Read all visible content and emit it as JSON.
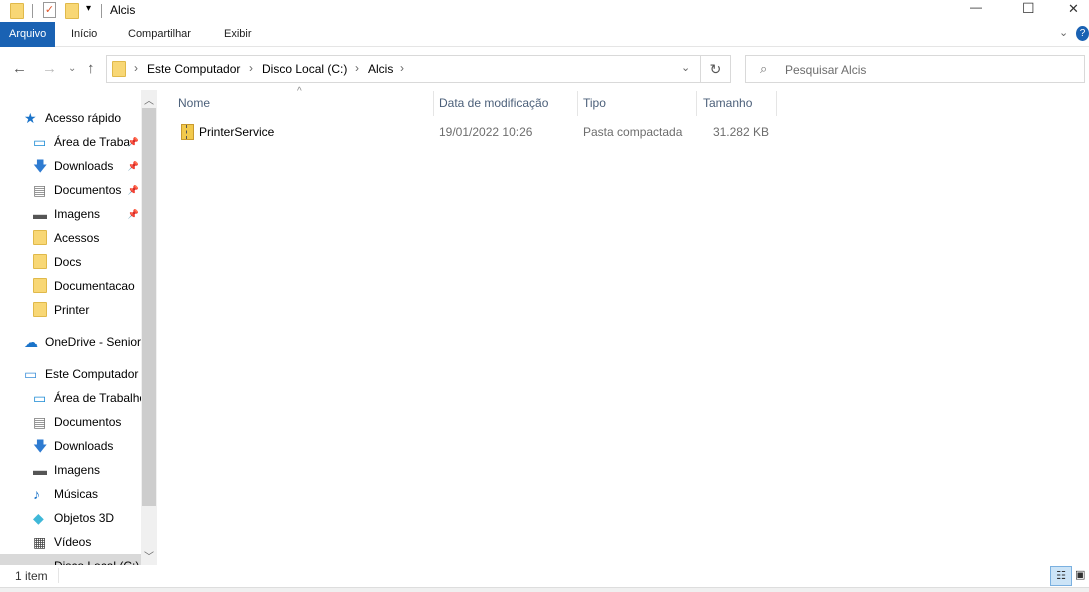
{
  "window": {
    "title": "Alcis",
    "minimize": "—",
    "maximize": "☐",
    "close": "✕"
  },
  "ribbon": {
    "tabs": [
      "Arquivo",
      "Início",
      "Compartilhar",
      "Exibir"
    ],
    "active_color": "#1a62b3"
  },
  "address": {
    "breadcrumbs": [
      "Este Computador",
      "Disco Local (C:)",
      "Alcis"
    ],
    "search_placeholder": "Pesquisar Alcis"
  },
  "nav": {
    "items": [
      {
        "label": "Acesso rápido",
        "icon": "star-icon",
        "level": 0,
        "pinned": false
      },
      {
        "label": "Área de Traba",
        "icon": "desktop-icon",
        "level": 1,
        "pinned": true
      },
      {
        "label": "Downloads",
        "icon": "download-icon",
        "level": 1,
        "pinned": true
      },
      {
        "label": "Documentos",
        "icon": "document-icon",
        "level": 1,
        "pinned": true
      },
      {
        "label": "Imagens",
        "icon": "image-icon",
        "level": 1,
        "pinned": true
      },
      {
        "label": "Acessos",
        "icon": "folder-icon",
        "level": 1,
        "pinned": false
      },
      {
        "label": "Docs",
        "icon": "folder-icon",
        "level": 1,
        "pinned": false
      },
      {
        "label": "Documentacao",
        "icon": "folder-icon",
        "level": 1,
        "pinned": false
      },
      {
        "label": "Printer",
        "icon": "folder-icon",
        "level": 1,
        "pinned": false
      },
      {
        "label": "OneDrive - Senior",
        "icon": "cloud-icon",
        "level": 0,
        "pinned": false,
        "gap": true
      },
      {
        "label": "Este Computador",
        "icon": "computer-icon",
        "level": 0,
        "pinned": false,
        "gap": true
      },
      {
        "label": "Área de Trabalho",
        "icon": "desktop-icon",
        "level": 1,
        "pinned": false
      },
      {
        "label": "Documentos",
        "icon": "document-icon",
        "level": 1,
        "pinned": false
      },
      {
        "label": "Downloads",
        "icon": "download-icon",
        "level": 1,
        "pinned": false
      },
      {
        "label": "Imagens",
        "icon": "image-icon",
        "level": 1,
        "pinned": false
      },
      {
        "label": "Músicas",
        "icon": "music-icon",
        "level": 1,
        "pinned": false
      },
      {
        "label": "Objetos 3D",
        "icon": "cube-icon",
        "level": 1,
        "pinned": false
      },
      {
        "label": "Vídeos",
        "icon": "video-icon",
        "level": 1,
        "pinned": false
      },
      {
        "label": "Disco Local (C:)",
        "icon": "drive-icon",
        "level": 1,
        "pinned": false,
        "selected": true
      }
    ]
  },
  "columns": [
    "Nome",
    "Data de modificação",
    "Tipo",
    "Tamanho"
  ],
  "files": [
    {
      "name": "PrinterService",
      "modified": "19/01/2022 10:26",
      "type": "Pasta compactada",
      "size": "31.282 KB"
    }
  ],
  "status": {
    "count": "1 item"
  }
}
